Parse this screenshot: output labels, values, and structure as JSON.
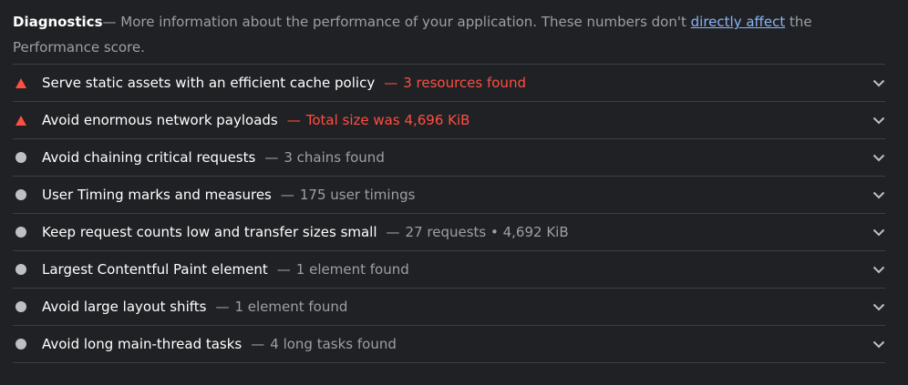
{
  "header": {
    "title": "Diagnostics",
    "description_prefix": "— More information about the performance of your application. These numbers don't ",
    "link_text": "directly affect",
    "description_suffix": " the Performance score."
  },
  "audits": [
    {
      "status": "fail",
      "status_color": "#ff4e42",
      "label": "Serve static assets with an efficient cache policy",
      "separator": "—",
      "detail": "3 resources found"
    },
    {
      "status": "fail",
      "status_color": "#ff4e42",
      "label": "Avoid enormous network payloads",
      "separator": "—",
      "detail": "Total size was 4,696 KiB"
    },
    {
      "status": "info",
      "status_color": "#bdc1c6",
      "label": "Avoid chaining critical requests",
      "separator": "—",
      "detail": "3 chains found"
    },
    {
      "status": "info",
      "status_color": "#bdc1c6",
      "label": "User Timing marks and measures",
      "separator": "—",
      "detail": "175 user timings"
    },
    {
      "status": "info",
      "status_color": "#bdc1c6",
      "label": "Keep request counts low and transfer sizes small",
      "separator": "—",
      "detail": "27 requests • 4,692 KiB"
    },
    {
      "status": "info",
      "status_color": "#bdc1c6",
      "label": "Largest Contentful Paint element",
      "separator": "—",
      "detail": "1 element found"
    },
    {
      "status": "info",
      "status_color": "#bdc1c6",
      "label": "Avoid large layout shifts",
      "separator": "—",
      "detail": "1 element found"
    },
    {
      "status": "info",
      "status_color": "#bdc1c6",
      "label": "Avoid long main-thread tasks",
      "separator": "—",
      "detail": "4 long tasks found"
    }
  ],
  "icons": {
    "fail": "warning-triangle-icon",
    "info": "info-dot-icon",
    "expand": "chevron-down-icon"
  }
}
